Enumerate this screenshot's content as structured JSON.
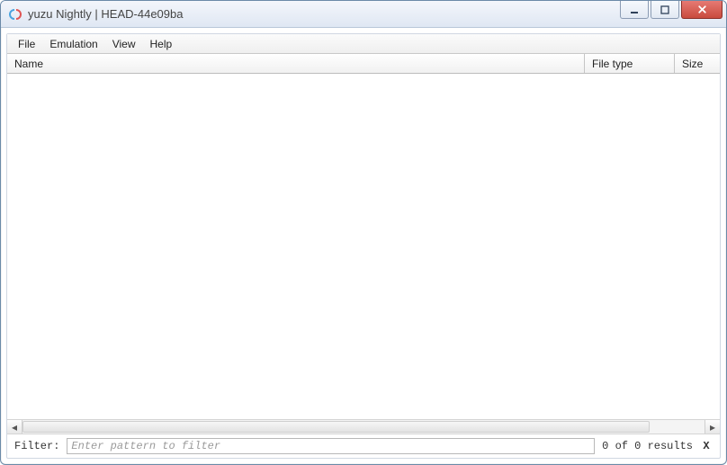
{
  "window": {
    "title": "yuzu Nightly | HEAD-44e09ba"
  },
  "menu": {
    "items": [
      {
        "label": "File"
      },
      {
        "label": "Emulation"
      },
      {
        "label": "View"
      },
      {
        "label": "Help"
      }
    ]
  },
  "columns": {
    "name": "Name",
    "file_type": "File type",
    "size": "Size"
  },
  "filter": {
    "label": "Filter:",
    "placeholder": "Enter pattern to filter",
    "value": "",
    "results": "0 of 0 results",
    "clear": "X"
  }
}
